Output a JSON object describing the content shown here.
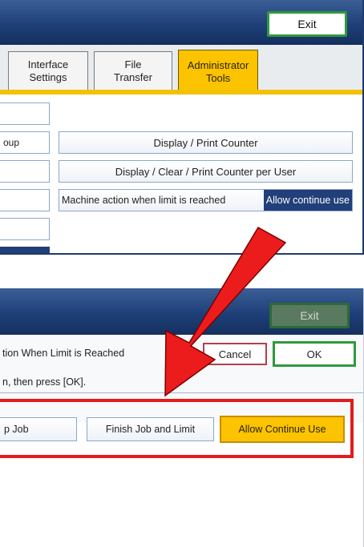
{
  "top_screen": {
    "exit_label": "Exit",
    "tabs": [
      {
        "label": "Interface\nSettings"
      },
      {
        "label": "File\nTransfer"
      },
      {
        "label": "Administrator\nTools"
      }
    ],
    "left_stub_label": "oup",
    "menu": {
      "display_print_counter": "Display / Print Counter",
      "display_clear_print_counter_per_user": "Display / Clear / Print Counter per User",
      "machine_action_label": "Machine action when limit is reached",
      "machine_action_value": "Allow continue use"
    }
  },
  "bottom_screen": {
    "exit_label": "Exit",
    "dialog_title": "tion When Limit is Reached",
    "cancel_label": "Cancel",
    "ok_label": "OK",
    "instruction": "n, then press [OK].",
    "choices": {
      "stop_job": "p Job",
      "finish_job_and_limit": "Finish Job and Limit",
      "allow_continue_use": "Allow Continue Use"
    }
  },
  "colors": {
    "title_bar": "#1e3f78",
    "selected_tab": "#fbc300",
    "exit_border": "#2e9a3c",
    "highlight_red": "#e31c1c"
  }
}
